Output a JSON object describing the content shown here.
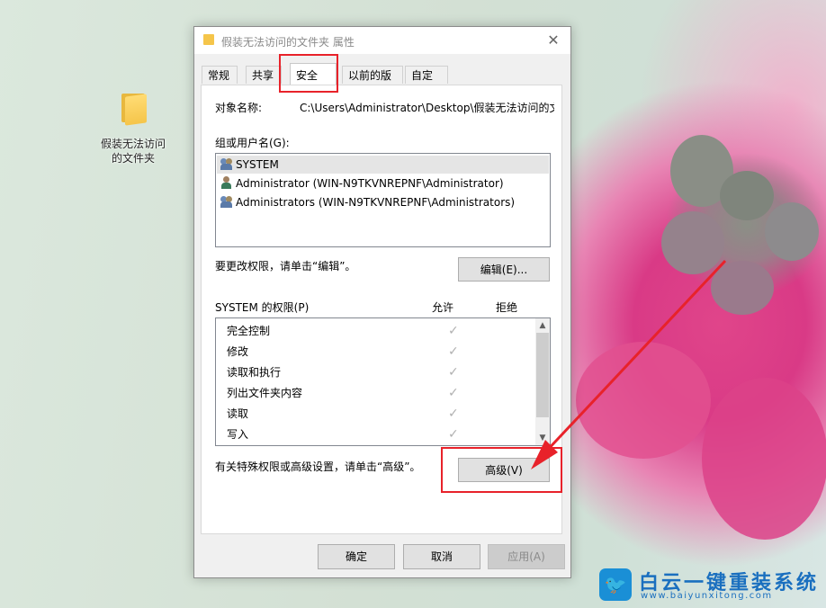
{
  "desktop": {
    "icon_label": "假装无法访问的文件夹"
  },
  "dialog": {
    "title": "假装无法访问的文件夹 属性",
    "close_glyph": "✕",
    "tabs": [
      {
        "label": "常规",
        "active": false
      },
      {
        "label": "共享",
        "active": false
      },
      {
        "label": "安全",
        "active": true
      },
      {
        "label": "以前的版本",
        "active": false
      },
      {
        "label": "自定义",
        "active": false
      }
    ],
    "object_name_label": "对象名称:",
    "object_name_value": "C:\\Users\\Administrator\\Desktop\\假装无法访问的文",
    "groups_label": "组或用户名(G):",
    "users": [
      {
        "name": "SYSTEM",
        "icon": "user-group-icon",
        "selected": true
      },
      {
        "name": "Administrator (WIN-N9TKVNREPNF\\Administrator)",
        "icon": "user-icon",
        "selected": false
      },
      {
        "name": "Administrators (WIN-N9TKVNREPNF\\Administrators)",
        "icon": "user-group-icon",
        "selected": false
      }
    ],
    "edit_hint": "要更改权限，请单击“编辑”。",
    "edit_button": "编辑(E)...",
    "perms_header": "SYSTEM 的权限(P)",
    "allow_header": "允许",
    "deny_header": "拒绝",
    "permissions": [
      {
        "name": "完全控制",
        "allow": "✓"
      },
      {
        "name": "修改",
        "allow": "✓"
      },
      {
        "name": "读取和执行",
        "allow": "✓"
      },
      {
        "name": "列出文件夹内容",
        "allow": "✓"
      },
      {
        "name": "读取",
        "allow": "✓"
      },
      {
        "name": "写入",
        "allow": "✓"
      }
    ],
    "advanced_hint": "有关特殊权限或高级设置，请单击“高级”。",
    "advanced_button": "高级(V)",
    "ok_button": "确定",
    "cancel_button": "取消",
    "apply_button": "应用(A)"
  },
  "watermark": {
    "title": "白云一键重装系统",
    "url": "www.baiyunxitong.com"
  },
  "colors": {
    "highlight_red": "#e8222a",
    "watermark_blue": "#1a6fbf"
  }
}
